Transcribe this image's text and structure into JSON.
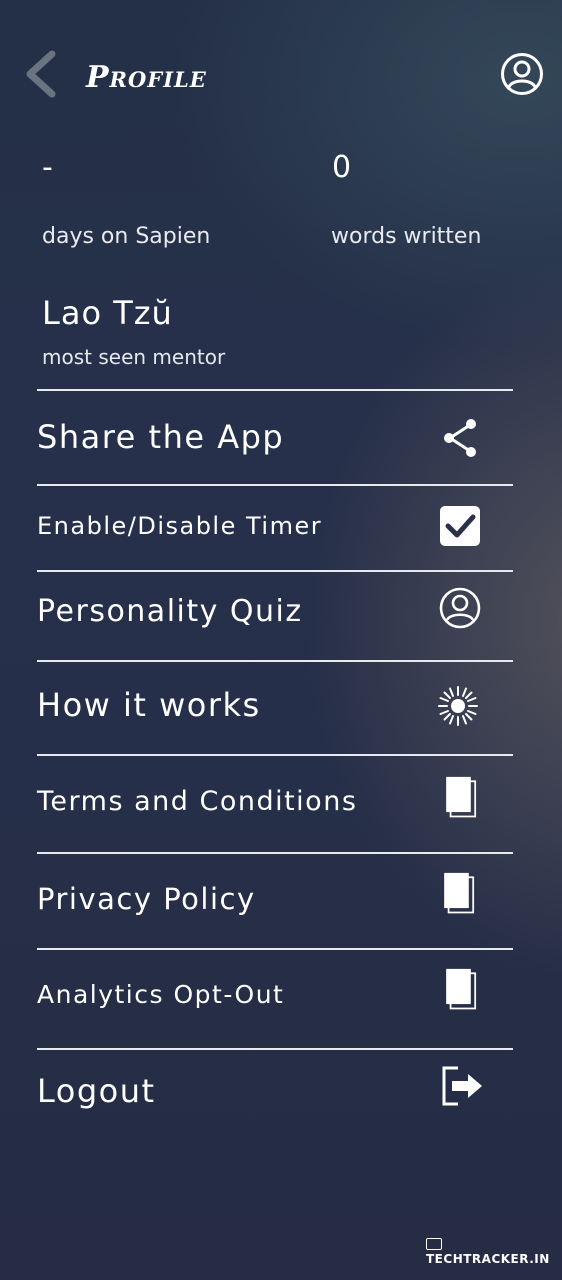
{
  "header": {
    "title": "Profile",
    "back_icon": "chevron-left-icon",
    "profile_icon": "user-circle-icon"
  },
  "stats": {
    "days_value": "-",
    "days_label": "days on Sapien",
    "words_value": "0",
    "words_label": "words written"
  },
  "mentor": {
    "name": "Lao Tzŭ",
    "label": "most seen mentor"
  },
  "menu": [
    {
      "label": "Share the App",
      "icon": "share-icon"
    },
    {
      "label": "Enable/Disable Timer",
      "icon": "checkbox-checked-icon"
    },
    {
      "label": "Personality Quiz",
      "icon": "user-circle-icon"
    },
    {
      "label": "How it works",
      "icon": "sunburst-icon"
    },
    {
      "label": "Terms and Conditions",
      "icon": "document-icon"
    },
    {
      "label": "Privacy Policy",
      "icon": "document-icon"
    },
    {
      "label": "Analytics Opt-Out",
      "icon": "document-icon"
    },
    {
      "label": "Logout",
      "icon": "logout-icon"
    }
  ],
  "watermark": "TECHTRACKER.IN",
  "colors": {
    "background": "#262f49",
    "text": "#ffffff",
    "back_arrow": "#6b7280"
  }
}
